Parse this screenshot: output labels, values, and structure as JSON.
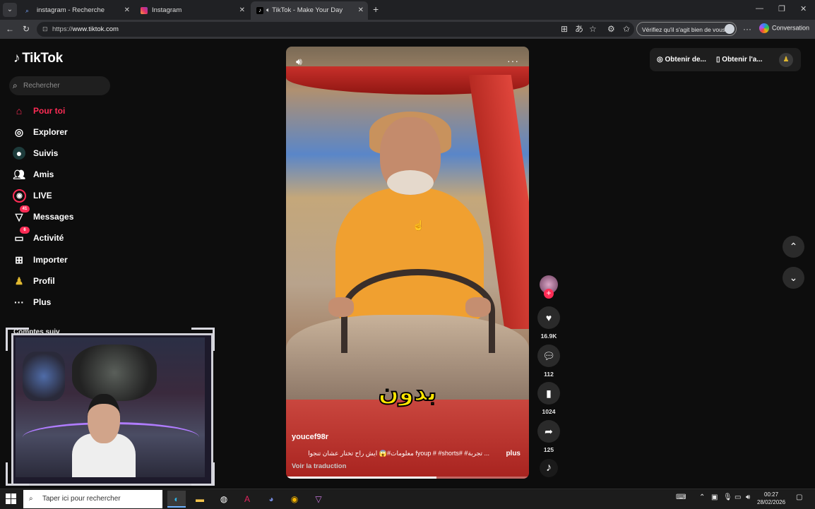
{
  "browser": {
    "tabs": [
      {
        "title": "instagram - Recherche",
        "active": false
      },
      {
        "title": "Instagram",
        "active": false
      },
      {
        "title": "TikTok - Make Your Day",
        "active": true
      }
    ],
    "url_prefix": "https://",
    "url_host": "www.tiktok.com",
    "verify_label": "Vérifiez qu'il s'agit bien de vous",
    "conversation_label": "Conversation"
  },
  "sidebar": {
    "logo": "TikTok",
    "search_placeholder": "Rechercher",
    "items": [
      {
        "label": "Pour toi",
        "icon": "home-icon",
        "active": true
      },
      {
        "label": "Explorer",
        "icon": "compass-icon"
      },
      {
        "label": "Suivis",
        "icon": "following-icon"
      },
      {
        "label": "Amis",
        "icon": "friends-icon"
      },
      {
        "label": "LIVE",
        "icon": "live-icon"
      },
      {
        "label": "Messages",
        "icon": "messages-icon",
        "badge": "41"
      },
      {
        "label": "Activité",
        "icon": "activity-icon",
        "badge": "6"
      },
      {
        "label": "Importer",
        "icon": "upload-icon"
      },
      {
        "label": "Profil",
        "icon": "profile-icon"
      },
      {
        "label": "Plus",
        "icon": "more-icon"
      }
    ],
    "suggested_label": "Comptes suiv"
  },
  "video": {
    "caption_overlay": "بدون",
    "username": "youcef98r",
    "description": "... تجربة# #fyoup # #shorts معلومات#😱 ايش راح تختار عشان تنجوا",
    "more_label": "plus",
    "translate_label": "Voir la traduction",
    "progress": 0.62
  },
  "actions": {
    "likes": "16.9K",
    "comments": "112",
    "saves": "1024",
    "shares": "125"
  },
  "top_buttons": {
    "get_coins": "Obtenir de...",
    "get_app": "Obtenir l'a..."
  },
  "taskbar": {
    "search_placeholder": "Taper ici pour rechercher",
    "time": "00:27",
    "date": "28/02/2026"
  },
  "colors": {
    "accent": "#fe2c55",
    "page_bg": "#0d0d0d",
    "caption": "#ffe600"
  }
}
